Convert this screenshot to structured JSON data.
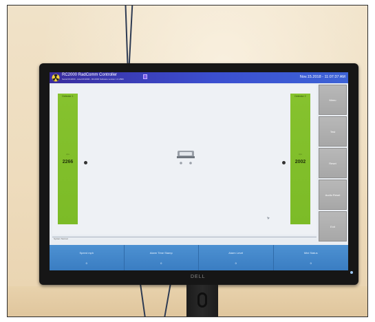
{
  "app": {
    "title": "RC2000 RadComm Controller",
    "subtitle": "Serial RC2000 - Axial RC2000 - RC2000 Software version 1.0.2809",
    "datetime": "Nov.15.2018 - 11:07:37 AM",
    "logo_icon": "radiation-trefoil-icon"
  },
  "monitor": {
    "brand": "DELL"
  },
  "detectors": [
    {
      "label": "Detector 1",
      "unit": "cps",
      "value": "2266"
    },
    {
      "label": "Detector 2",
      "unit": "cps",
      "value": "2002"
    }
  ],
  "center": {
    "icon": "vehicle-icon"
  },
  "status": {
    "text": "System Normal"
  },
  "side_buttons": [
    {
      "label": "Menu"
    },
    {
      "label": "Test"
    },
    {
      "label": "Reset"
    },
    {
      "label": "Audio Reset"
    },
    {
      "label": "Exit"
    }
  ],
  "bottom_bar": [
    {
      "label": "Speed mph",
      "value": "0"
    },
    {
      "label": "Alarm Time Stamp",
      "value": "0"
    },
    {
      "label": "Alarm Level",
      "value": "0"
    },
    {
      "label": "Mini Status",
      "value": "0"
    }
  ],
  "colors": {
    "titlebar": "#3b4fd0",
    "detector_panel": "#86c22e",
    "side_button": "#b0b0b0",
    "bottom_bar": "#4a8fd0"
  }
}
